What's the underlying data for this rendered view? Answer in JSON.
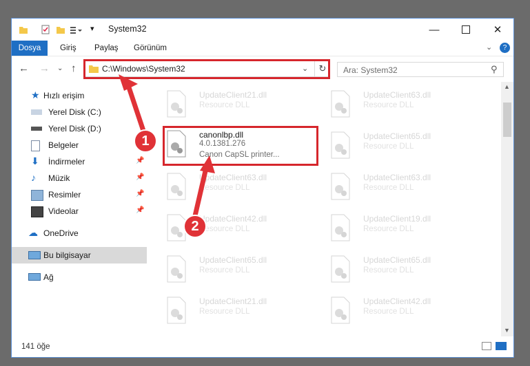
{
  "window": {
    "title": "System32"
  },
  "ribbon": {
    "tabs": [
      "Dosya",
      "Giriş",
      "Paylaş",
      "Görünüm"
    ]
  },
  "address": {
    "path": "C:\\Windows\\System32"
  },
  "search": {
    "placeholder": "Ara: System32"
  },
  "sidebar": {
    "items": [
      {
        "label": "Hızlı erişim",
        "icon": "star-icon"
      },
      {
        "label": "Yerel Disk (C:)",
        "icon": "drive-icon"
      },
      {
        "label": "Yerel Disk (D:)",
        "icon": "drive-icon"
      },
      {
        "label": "Belgeler",
        "icon": "documents-icon"
      },
      {
        "label": "İndirmeler",
        "icon": "download-icon"
      },
      {
        "label": "Müzik",
        "icon": "music-icon"
      },
      {
        "label": "Resimler",
        "icon": "pictures-icon"
      },
      {
        "label": "Videolar",
        "icon": "videos-icon"
      },
      {
        "label": "OneDrive",
        "icon": "cloud-icon"
      },
      {
        "label": "Bu bilgisayar",
        "icon": "computer-icon"
      },
      {
        "label": "Ağ",
        "icon": "network-icon"
      }
    ]
  },
  "files": {
    "left": [
      {
        "name": "UpdateClient21.dll",
        "desc": "Resource DLL"
      },
      {
        "name": "canonlbp.dll",
        "desc": "4.0.1381.276",
        "desc2": "Canon CapSL printer..."
      },
      {
        "name": "UpdateClient63.dll",
        "desc": "Resource DLL"
      },
      {
        "name": "UpdateClient42.dll",
        "desc": "Resource DLL"
      },
      {
        "name": "UpdateClient65.dll",
        "desc": "Resource DLL"
      },
      {
        "name": "UpdateClient21.dll",
        "desc": "Resource DLL"
      }
    ],
    "right": [
      {
        "name": "UpdateClient63.dll",
        "desc": "Resource DLL"
      },
      {
        "name": "UpdateClient65.dll",
        "desc": "Resource DLL"
      },
      {
        "name": "UpdateClient63.dll",
        "desc": "Resource DLL"
      },
      {
        "name": "UpdateClient19.dll",
        "desc": "Resource DLL"
      },
      {
        "name": "UpdateClient65.dll",
        "desc": "Resource DLL"
      },
      {
        "name": "UpdateClient42.dll",
        "desc": "Resource DLL"
      }
    ]
  },
  "status": {
    "count": "141 öğe"
  },
  "badges": [
    "1",
    "2"
  ],
  "colors": {
    "accent": "#1f6fc4",
    "highlight": "#d6262c"
  }
}
